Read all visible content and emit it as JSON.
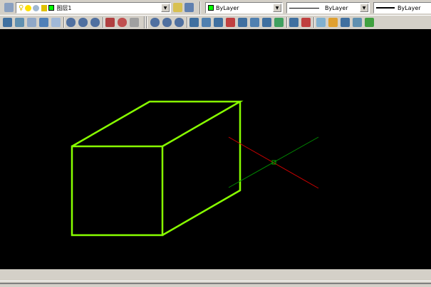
{
  "layer_toolbar": {
    "layer_name": "图层1",
    "layer_color": "#00ff00"
  },
  "properties_toolbar": {
    "color_value": "ByLayer",
    "color_swatch": "#00ff00",
    "linetype_value": "ByLayer",
    "lineweight_value": "ByLayer"
  },
  "toolbar2_icons": [
    "box-icon",
    "wedge-icon",
    "sweep-icon",
    "loft-icon",
    "flask-icon",
    "union-icon",
    "subtract-icon",
    "intersect-icon",
    "3d-move-icon",
    "3d-rotate-icon",
    "3d-align-icon",
    "union-icon",
    "subtract-icon",
    "intersect-icon",
    "extrude-faces-icon",
    "move-faces-icon",
    "offset-faces-icon",
    "delete-faces-icon",
    "rotate-faces-icon",
    "taper-faces-icon",
    "copy-faces-icon",
    "color-faces-icon",
    "imprint-icon",
    "color-edges-icon",
    "separate-icon",
    "clean-icon",
    "shell-icon",
    "check-icon"
  ],
  "drawing": {
    "object_color": "#88ff00",
    "ucs_x_color": "#cc0000",
    "ucs_y_color": "#008800"
  }
}
